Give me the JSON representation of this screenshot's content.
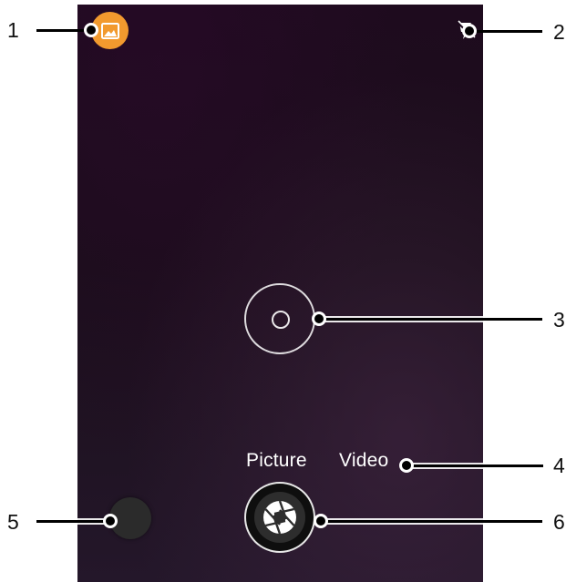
{
  "camera": {
    "modes": {
      "picture_label": "Picture",
      "video_label": "Video"
    },
    "icons": {
      "gallery": "gallery-icon",
      "flash": "flash-off-icon",
      "focus": "focus-icon",
      "switch": "camera-switch-icon",
      "shutter": "aperture-icon"
    },
    "colors": {
      "gallery_accent": "#f29a2e",
      "background": "#1e0b1e"
    }
  },
  "callouts": [
    {
      "number": "1"
    },
    {
      "number": "2"
    },
    {
      "number": "3"
    },
    {
      "number": "4"
    },
    {
      "number": "5"
    },
    {
      "number": "6"
    }
  ]
}
